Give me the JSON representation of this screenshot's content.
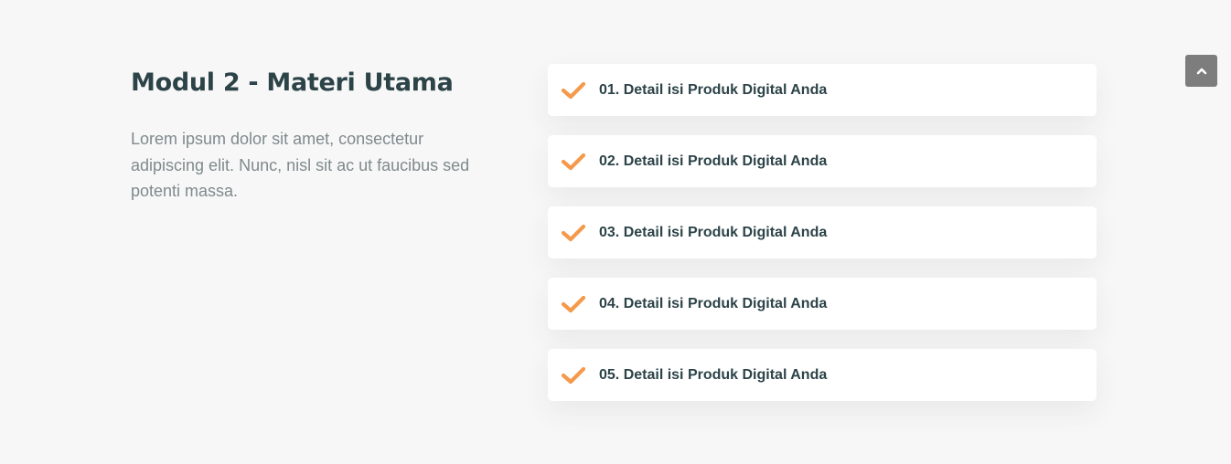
{
  "module": {
    "title": "Modul 2 - Materi Utama",
    "description": "Lorem ipsum dolor sit amet, consectetur adipiscing elit. Nunc, nisl sit ac ut faucibus sed potenti massa."
  },
  "items": [
    {
      "label": "01. Detail isi Produk Digital Anda",
      "icon": "check-icon"
    },
    {
      "label": "02. Detail isi Produk Digital Anda",
      "icon": "check-icon"
    },
    {
      "label": "03. Detail isi Produk Digital Anda",
      "icon": "check-icon"
    },
    {
      "label": "04. Detail isi Produk Digital Anda",
      "icon": "check-icon"
    },
    {
      "label": "05. Detail isi Produk Digital Anda",
      "icon": "check-icon"
    }
  ],
  "scroll_top": {
    "icon": "chevron-up-icon"
  },
  "colors": {
    "accent": "#f5994b",
    "heading": "#2c4348",
    "body_text": "#7f8a8c",
    "background": "#f7f7f7",
    "card": "#ffffff",
    "scroll_button": "#7d7d7d"
  }
}
